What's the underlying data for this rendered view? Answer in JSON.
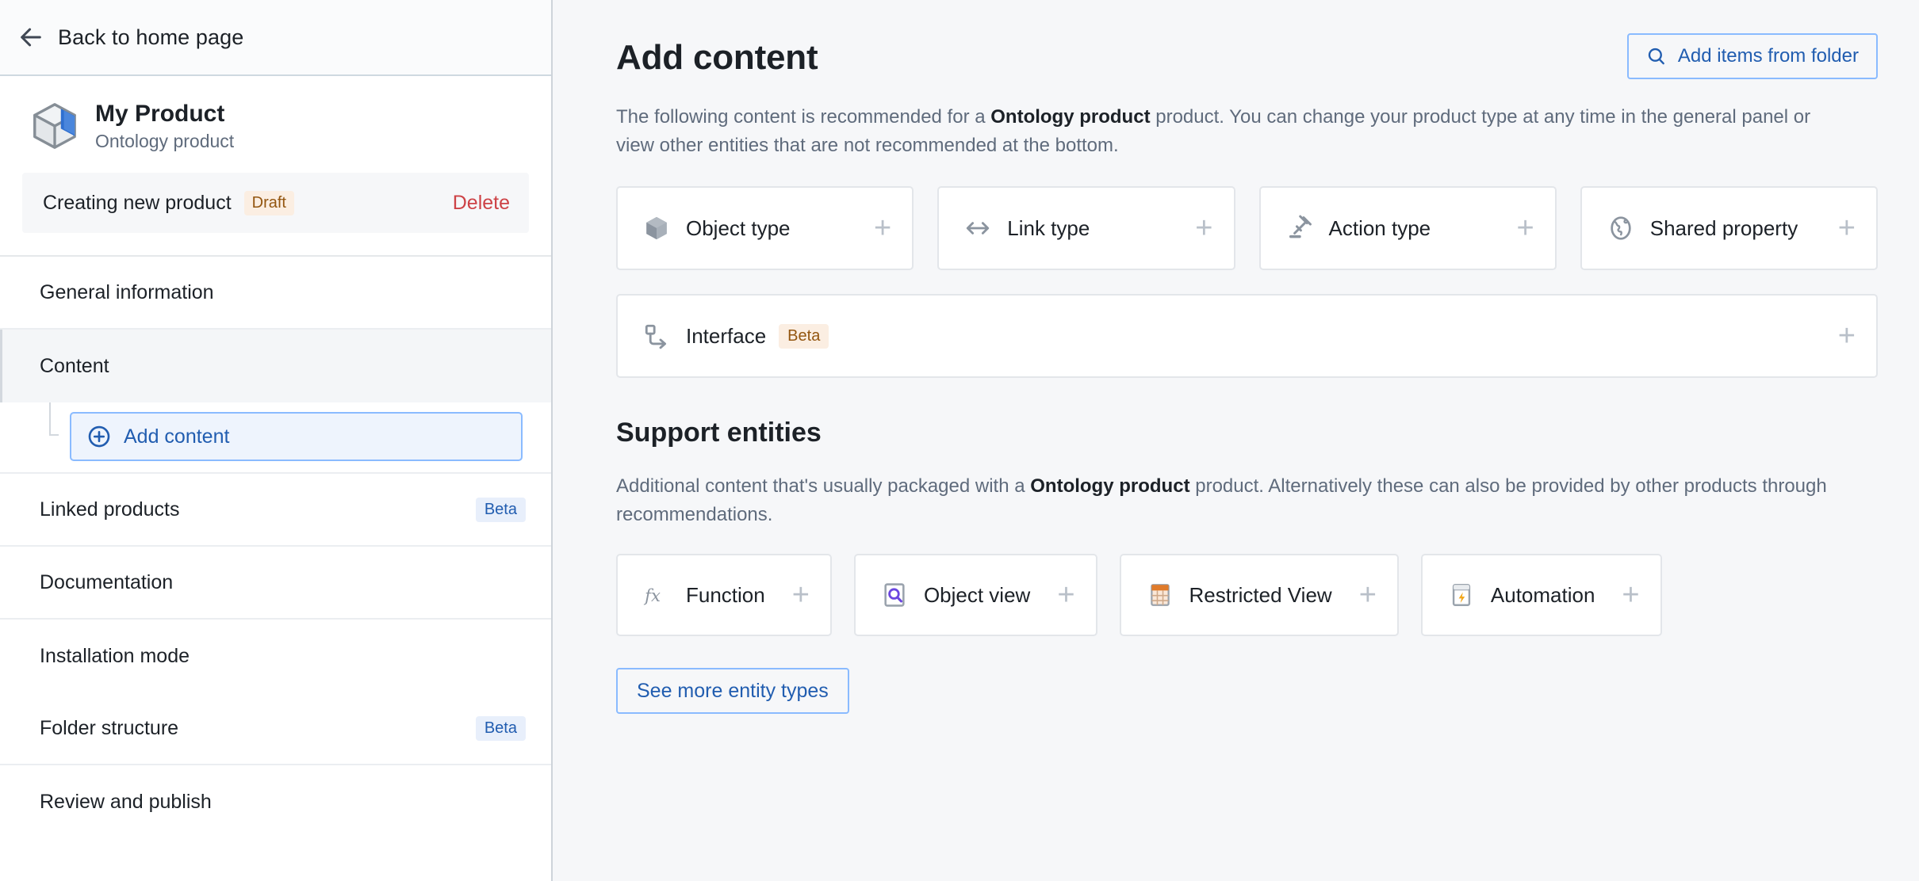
{
  "sidebar": {
    "back_label": "Back to home page",
    "product": {
      "name": "My Product",
      "type": "Ontology product",
      "icon": "cube-icon"
    },
    "status_row": {
      "text": "Creating new product",
      "badge": "Draft",
      "delete_label": "Delete"
    },
    "nav": [
      {
        "label": "General information",
        "badge": "",
        "active": false
      },
      {
        "label": "Content",
        "badge": "",
        "active": true
      },
      {
        "label": "Linked products",
        "badge": "Beta",
        "active": false
      },
      {
        "label": "Documentation",
        "badge": "",
        "active": false
      },
      {
        "label": "Installation mode",
        "badge": "",
        "active": false
      },
      {
        "label": "Folder structure",
        "badge": "Beta",
        "active": false
      },
      {
        "label": "Review and publish",
        "badge": "",
        "active": false
      }
    ],
    "subitem": {
      "label": "Add content",
      "icon": "plus-circle-icon"
    }
  },
  "main": {
    "title": "Add content",
    "folder_button": {
      "label": "Add items from folder",
      "icon": "search-icon"
    },
    "lede_prefix": "The following content is recommended for a ",
    "lede_strong": "Ontology product",
    "lede_suffix": " product. You can change your product type at any time in the general panel or view other entities that are not recommended at the bottom.",
    "recommended_cards": [
      {
        "label": "Object type",
        "icon": "cube-outline-icon",
        "plus": "+"
      },
      {
        "label": "Link type",
        "icon": "double-arrow-icon",
        "plus": "+"
      },
      {
        "label": "Action type",
        "icon": "gavel-icon",
        "plus": "+"
      },
      {
        "label": "Shared property",
        "icon": "globe-icon",
        "plus": "+"
      }
    ],
    "wide_card": {
      "label": "Interface",
      "badge": "Beta",
      "icon": "interface-icon",
      "plus": "+"
    },
    "support": {
      "title": "Support entities",
      "lede_prefix": "Additional content that's usually packaged with a ",
      "lede_strong": "Ontology product",
      "lede_suffix": " product. Alternatively these can also be provided by other products through recommendations.",
      "cards": [
        {
          "label": "Function",
          "icon": "function-fx-icon",
          "plus": "+"
        },
        {
          "label": "Object view",
          "icon": "magnifier-doc-icon",
          "plus": "+"
        },
        {
          "label": "Restricted View",
          "icon": "table-orange-icon",
          "plus": "+"
        },
        {
          "label": "Automation",
          "icon": "lightning-window-icon",
          "plus": "+"
        }
      ],
      "see_more_label": "See more entity types"
    }
  },
  "colors": {
    "accent_blue": "#215db0",
    "border_blue": "#8abbff",
    "danger_red": "#cd4246",
    "badge_beta_bg": "#e8effb",
    "badge_draft_bg": "#fbeee2",
    "badge_draft_fg": "#935610",
    "main_bg": "#f6f7f9"
  }
}
